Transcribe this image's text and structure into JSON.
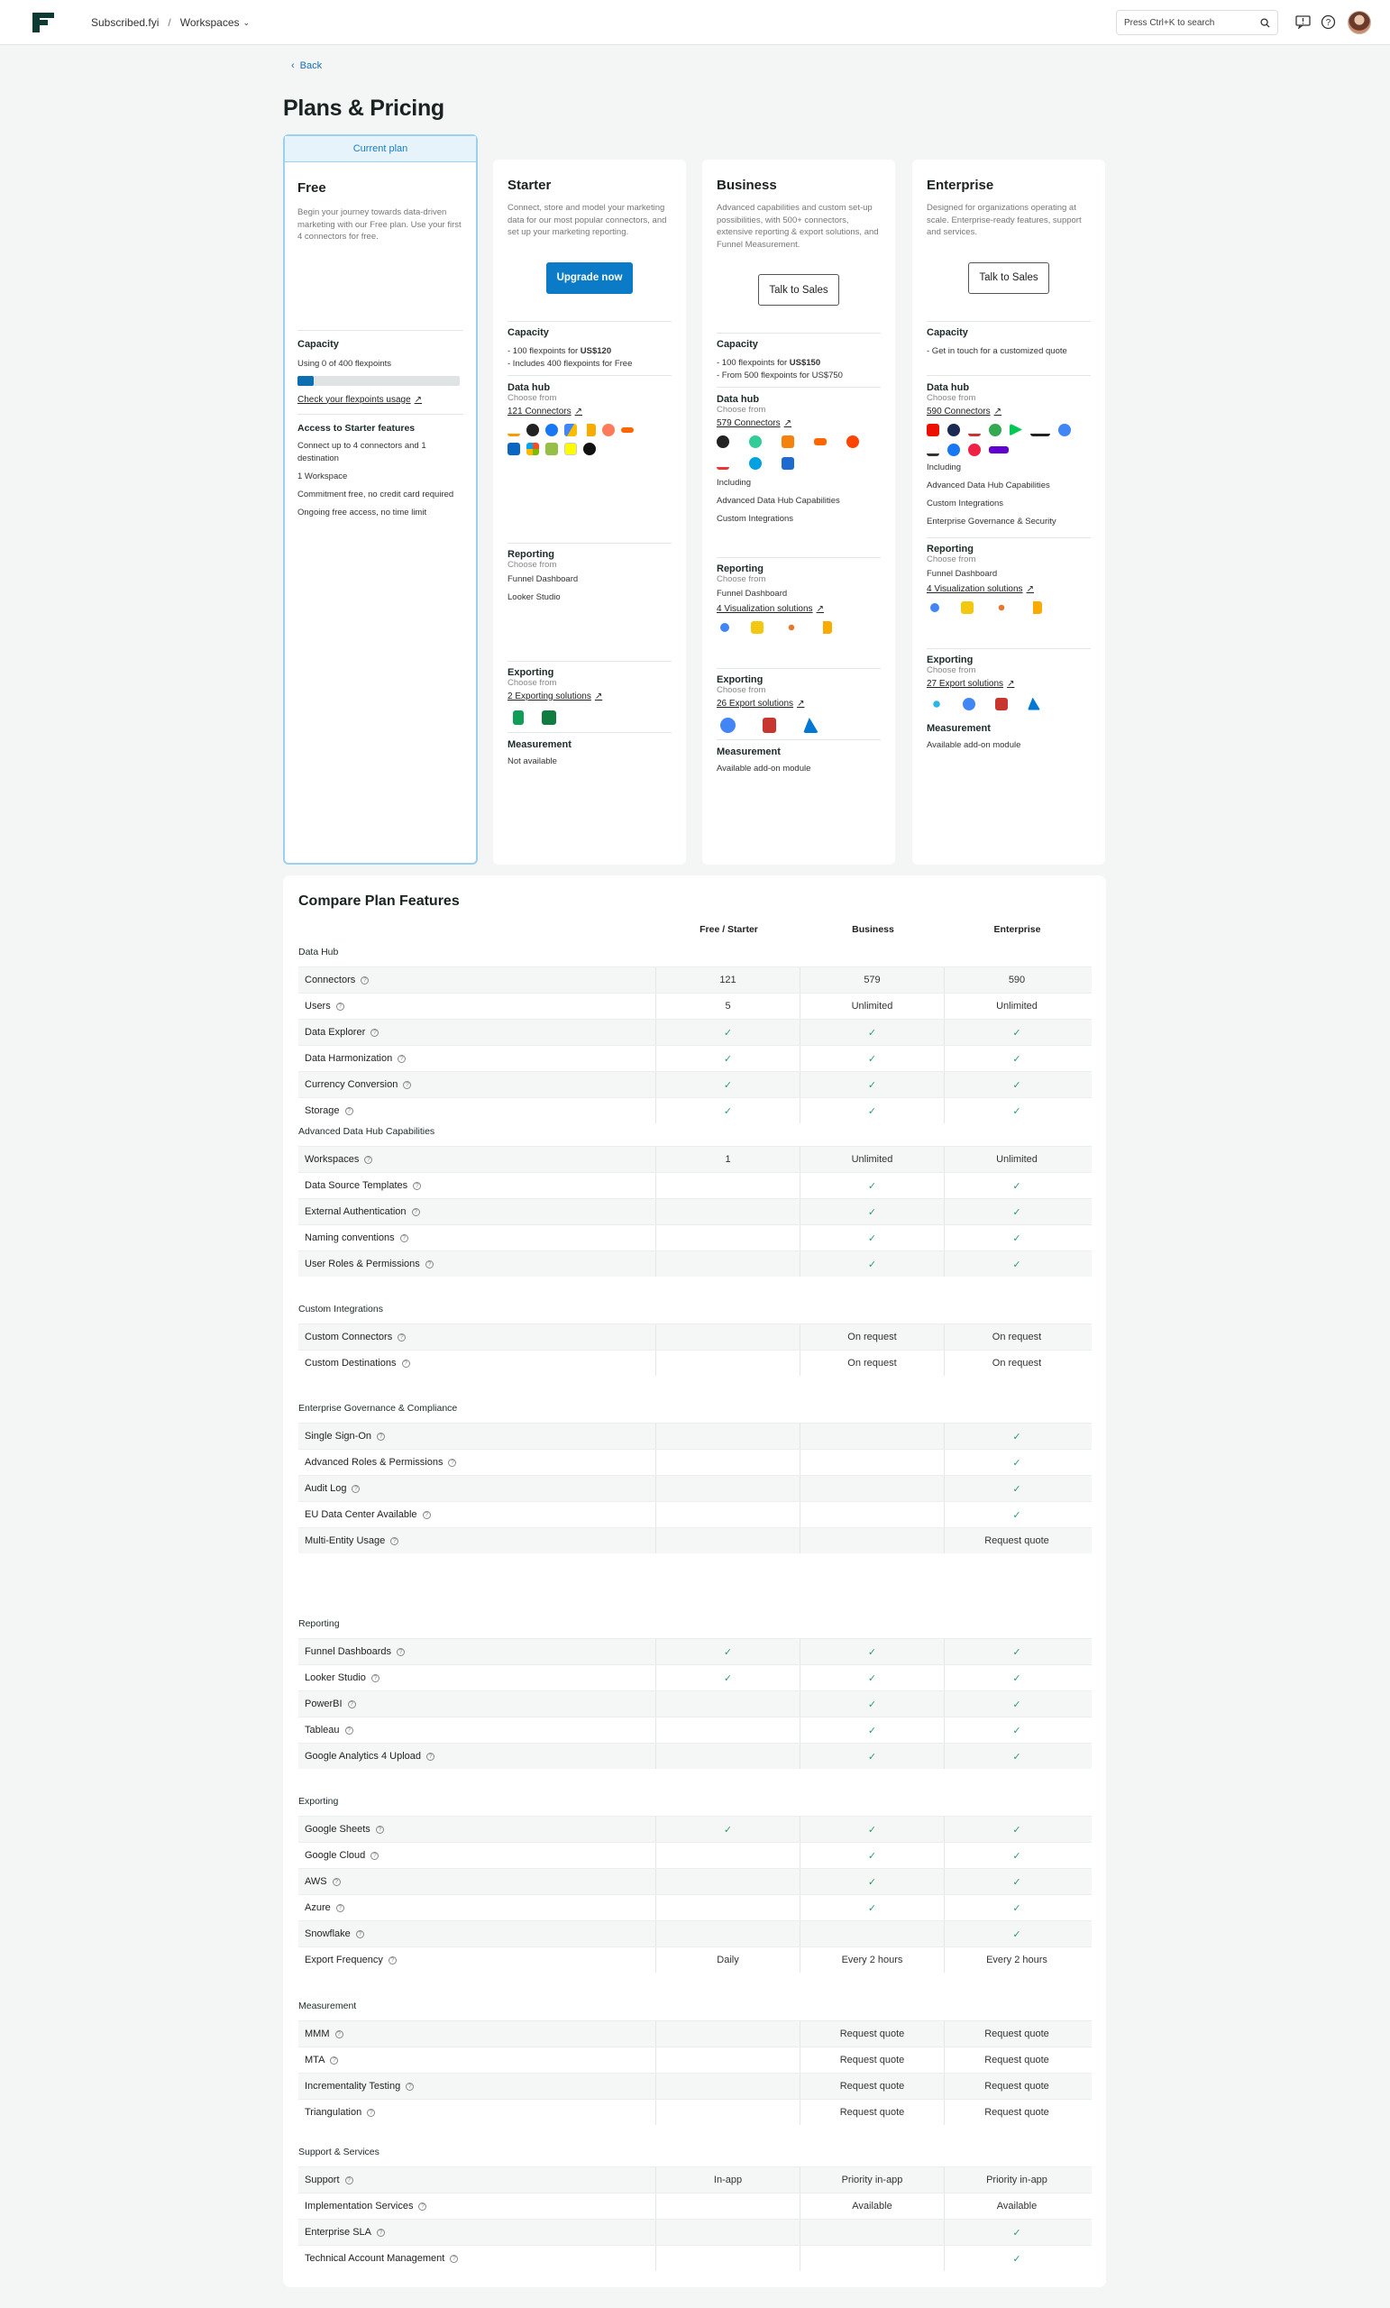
{
  "header": {
    "org": "Subscribed.fyi",
    "separator": "/",
    "workspace": "Workspaces",
    "search_placeholder": "Press Ctrl+K to search"
  },
  "back_label": "Back",
  "page_title": "Plans & Pricing",
  "plans": {
    "free": {
      "badge": "Current plan",
      "name": "Free",
      "desc": "Begin your journey towards data-driven marketing with our Free plan. Use your first 4 connectors for free.",
      "capacity_title": "Capacity",
      "capacity_text": "Using 0 of 400 flexpoints",
      "capacity_fraction": 0.05,
      "usage_link": "Check your flexpoints usage",
      "access_title": "Access to Starter features",
      "access_items": [
        "Connect up to 4 connectors and 1 destination",
        "1 Workspace",
        "Commitment free, no credit card required",
        "Ongoing free access, no time limit"
      ]
    },
    "starter": {
      "name": "Starter",
      "desc": "Connect, store and model your marketing data for our most popular connectors, and set up your marketing reporting.",
      "button": "Upgrade now",
      "capacity_title": "Capacity",
      "cap1_pre": "- 100 flexpoints for ",
      "cap1_bold": "US$120",
      "cap2": "- Includes 400 flexpoints for Free",
      "datahub_title": "Data hub",
      "choose": "Choose from",
      "connectors_link": "121 Connectors",
      "reporting_title": "Reporting",
      "reporting_items": [
        "Funnel Dashboard",
        "Looker Studio"
      ],
      "exporting_title": "Exporting",
      "export_link": "2 Exporting solutions",
      "measurement_title": "Measurement",
      "measurement_text": "Not available"
    },
    "business": {
      "name": "Business",
      "desc": "Advanced capabilities and custom set-up possibilities, with 500+ connectors, extensive reporting & export solutions, and Funnel Measurement.",
      "button": "Talk to Sales",
      "capacity_title": "Capacity",
      "cap1_pre": "- 100 flexpoints for ",
      "cap1_bold": "US$150",
      "cap2": "- From 500 flexpoints for US$750",
      "datahub_title": "Data hub",
      "choose": "Choose from",
      "connectors_link": "579 Connectors",
      "including": [
        "Including",
        "Advanced Data Hub Capabilities",
        "Custom Integrations"
      ],
      "reporting_title": "Reporting",
      "reporting_items": [
        "Funnel Dashboard"
      ],
      "viz_link": "4 Visualization solutions",
      "exporting_title": "Exporting",
      "export_link": "26 Export solutions",
      "measurement_title": "Measurement",
      "measurement_text": "Available add-on module"
    },
    "enterprise": {
      "name": "Enterprise",
      "desc": "Designed for organizations operating at scale. Enterprise-ready features, support and services.",
      "button": "Talk to Sales",
      "capacity_title": "Capacity",
      "cap1": "- Get in touch for a customized quote",
      "datahub_title": "Data hub",
      "choose": "Choose from",
      "connectors_link": "590 Connectors",
      "including": [
        "Including",
        "Advanced Data Hub Capabilities",
        "Custom Integrations",
        "Enterprise Governance & Security"
      ],
      "reporting_title": "Reporting",
      "reporting_items": [
        "Funnel Dashboard"
      ],
      "viz_link": "4 Visualization solutions",
      "exporting_title": "Exporting",
      "export_link": "27 Export solutions",
      "measurement_title": "Measurement",
      "measurement_text": "Available add-on module"
    }
  },
  "compare": {
    "title": "Compare Plan Features",
    "columns": [
      "Free / Starter",
      "Business",
      "Enterprise"
    ],
    "groups": [
      {
        "name": "Data Hub",
        "rows": [
          [
            "Connectors",
            "121",
            "579",
            "590"
          ],
          [
            "Users",
            "5",
            "Unlimited",
            "Unlimited"
          ],
          [
            "Data Explorer",
            "✓",
            "✓",
            "✓"
          ],
          [
            "Data Harmonization",
            "✓",
            "✓",
            "✓"
          ],
          [
            "Currency Conversion",
            "✓",
            "✓",
            "✓"
          ],
          [
            "Storage",
            "✓",
            "✓",
            "✓"
          ]
        ]
      },
      {
        "name": "Advanced Data Hub Capabilities",
        "rows": [
          [
            "Workspaces",
            "1",
            "Unlimited",
            "Unlimited"
          ],
          [
            "Data Source Templates",
            "",
            "✓",
            "✓"
          ],
          [
            "External Authentication",
            "",
            "✓",
            "✓"
          ],
          [
            "Naming conventions",
            "",
            "✓",
            "✓"
          ],
          [
            "User Roles & Permissions",
            "",
            "✓",
            "✓"
          ]
        ]
      },
      {
        "name": "Custom Integrations",
        "rows": [
          [
            "Custom Connectors",
            "",
            "On request",
            "On request"
          ],
          [
            "Custom Destinations",
            "",
            "On request",
            "On request"
          ]
        ]
      },
      {
        "name": "Enterprise Governance & Compliance",
        "rows": [
          [
            "Single Sign-On",
            "",
            "",
            "✓"
          ],
          [
            "Advanced Roles & Permissions",
            "",
            "",
            "✓"
          ],
          [
            "Audit Log",
            "",
            "",
            "✓"
          ],
          [
            "EU Data Center Available",
            "",
            "",
            "✓"
          ],
          [
            "Multi-Entity Usage",
            "",
            "",
            "Request quote"
          ]
        ]
      },
      {
        "name": "Reporting",
        "rows": [
          [
            "Funnel Dashboards",
            "✓",
            "✓",
            "✓"
          ],
          [
            "Looker Studio",
            "✓",
            "✓",
            "✓"
          ],
          [
            "PowerBI",
            "",
            "✓",
            "✓"
          ],
          [
            "Tableau",
            "",
            "✓",
            "✓"
          ],
          [
            "Google Analytics 4 Upload",
            "",
            "✓",
            "✓"
          ]
        ]
      },
      {
        "name": "Exporting",
        "rows": [
          [
            "Google Sheets",
            "✓",
            "✓",
            "✓"
          ],
          [
            "Google Cloud",
            "",
            "✓",
            "✓"
          ],
          [
            "AWS",
            "",
            "✓",
            "✓"
          ],
          [
            "Azure",
            "",
            "✓",
            "✓"
          ],
          [
            "Snowflake",
            "",
            "",
            "✓"
          ],
          [
            "Export Frequency",
            "Daily",
            "Every 2 hours",
            "Every 2 hours"
          ]
        ]
      },
      {
        "name": "Measurement",
        "rows": [
          [
            "MMM",
            "",
            "Request quote",
            "Request quote"
          ],
          [
            "MTA",
            "",
            "Request quote",
            "Request quote"
          ],
          [
            "Incrementality Testing",
            "",
            "Request quote",
            "Request quote"
          ],
          [
            "Triangulation",
            "",
            "Request quote",
            "Request quote"
          ]
        ]
      },
      {
        "name": "Support & Services",
        "rows": [
          [
            "Support",
            "In-app",
            "Priority in-app",
            "Priority in-app"
          ],
          [
            "Implementation Services",
            "",
            "Available",
            "Available"
          ],
          [
            "Enterprise SLA",
            "",
            "",
            "✓"
          ],
          [
            "Technical Account Management",
            "",
            "",
            "✓"
          ]
        ]
      }
    ]
  },
  "colors": {
    "accent": "#0b7bc7",
    "check": "#2aa06a",
    "current_border": "#9bd1ee"
  }
}
